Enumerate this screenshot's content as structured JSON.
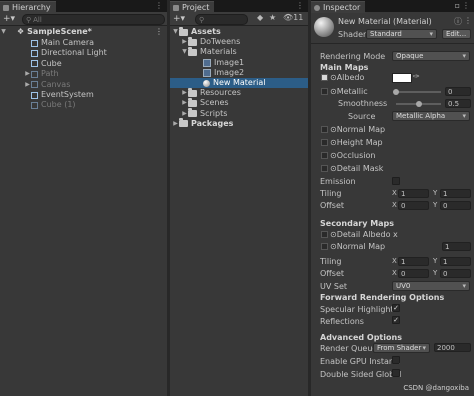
{
  "hierarchy": {
    "tab": "Hierarchy",
    "add_label": "+",
    "search_placeholder": "All",
    "scene": "SampleScene*",
    "items": [
      {
        "label": "Main Camera",
        "active": true
      },
      {
        "label": "Directional Light",
        "active": true
      },
      {
        "label": "Cube",
        "active": true
      },
      {
        "label": "Path",
        "active": false
      },
      {
        "label": "Canvas",
        "active": false
      },
      {
        "label": "EventSystem",
        "active": true
      },
      {
        "label": "Cube (1)",
        "active": false
      }
    ]
  },
  "project": {
    "tab": "Project",
    "add_label": "+",
    "hidden_count": "11",
    "tree": [
      {
        "label": "Assets",
        "bold": true
      },
      {
        "label": "DoTweens"
      },
      {
        "label": "Materials"
      },
      {
        "label": "Image1"
      },
      {
        "label": "Image2"
      },
      {
        "label": "New Material",
        "selected": true
      },
      {
        "label": "Resources"
      },
      {
        "label": "Scenes"
      },
      {
        "label": "Scripts"
      },
      {
        "label": "Packages",
        "bold": true
      }
    ]
  },
  "inspector": {
    "tab": "Inspector",
    "title": "New Material (Material)",
    "shader_label": "Shader",
    "shader_value": "Standard",
    "edit_button": "Edit...",
    "rendering_mode_label": "Rendering Mode",
    "rendering_mode_value": "Opaque",
    "main_maps": "Main Maps",
    "albedo": "Albedo",
    "metallic": "Metallic",
    "metallic_value": "0",
    "metallic_level": 0.0,
    "smoothness": "Smoothness",
    "smoothness_value": "0.5",
    "smoothness_level": 0.5,
    "source": "Source",
    "source_value": "Metallic Alpha",
    "normal_map": "Normal Map",
    "height_map": "Height Map",
    "occlusion": "Occlusion",
    "detail_mask": "Detail Mask",
    "emission": "Emission",
    "tiling": "Tiling",
    "offset": "Offset",
    "x": "X",
    "y": "Y",
    "tiling_x": "1",
    "tiling_y": "1",
    "offset_x": "0",
    "offset_y": "0",
    "secondary_maps": "Secondary Maps",
    "detail_albedo": "Detail Albedo x",
    "sec_normal_map": "Normal Map",
    "sec_normal_value": "1",
    "sec_tiling_x": "1",
    "sec_tiling_y": "1",
    "sec_offset_x": "0",
    "sec_offset_y": "0",
    "uv_set": "UV Set",
    "uv_set_value": "UV0",
    "forward_options": "Forward Rendering Options",
    "specular_highlights": "Specular Highlights",
    "reflections": "Reflections",
    "advanced_options": "Advanced Options",
    "render_queue": "Render Queue",
    "render_queue_mode": "From Shader",
    "render_queue_value": "2000",
    "gpu_instancing": "Enable GPU Instanci",
    "double_sided": "Double Sided Global",
    "watermark": "CSDN @dangoxiba"
  },
  "colors": {
    "selection": "#2c5d87",
    "panel": "#383838",
    "cube_icon": "#9ec3e8"
  }
}
